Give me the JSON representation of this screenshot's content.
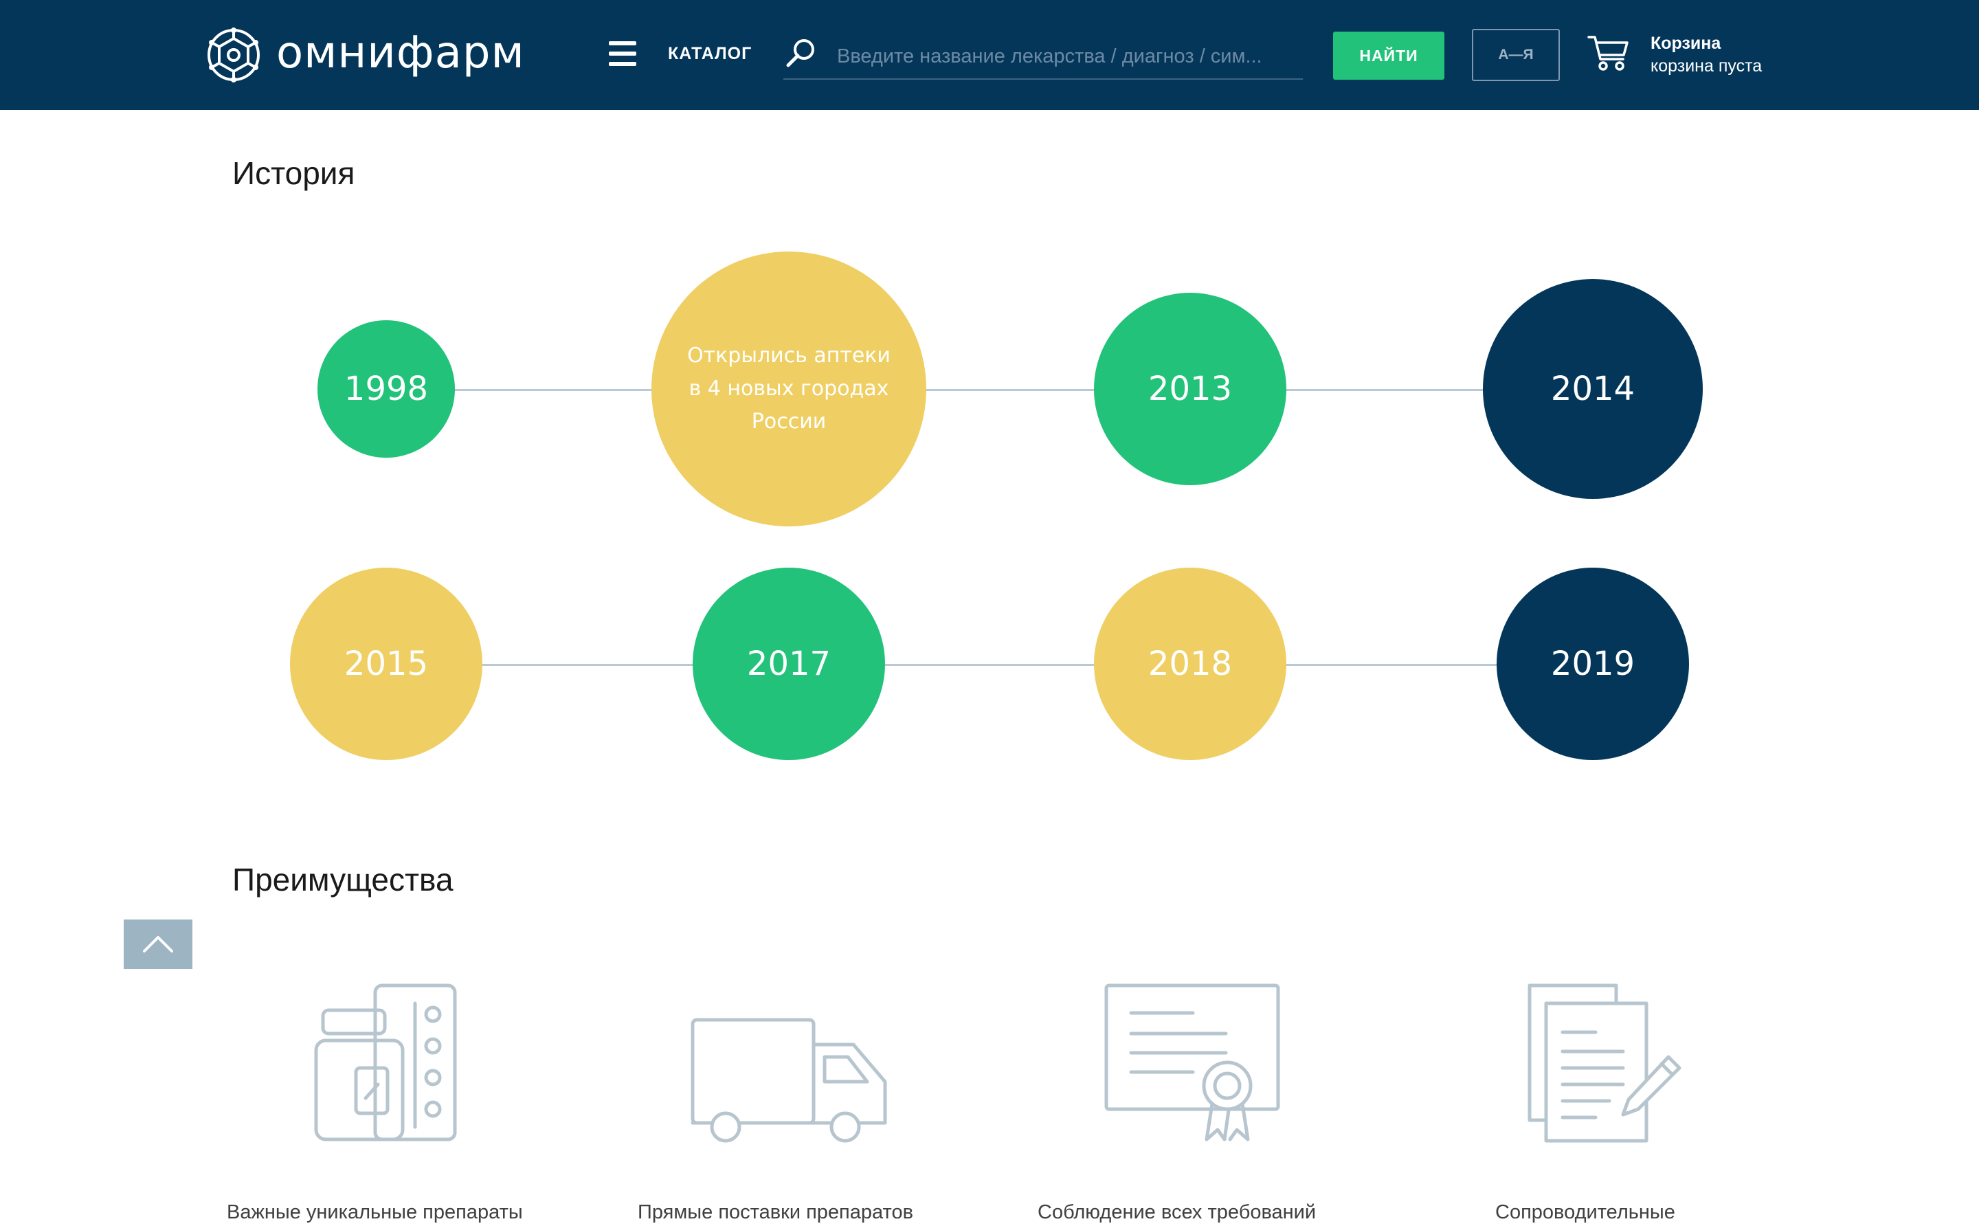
{
  "header": {
    "logo_text": "омнифарм",
    "catalog_label": "КАТАЛОГ",
    "search_placeholder": "Введите название лекарства / диагноз / сим...",
    "search_value": "",
    "find_button": "НАЙТИ",
    "az_button": "А—Я",
    "cart_title": "Корзина",
    "cart_status": "корзина пуста",
    "icons": [
      "logo-icon",
      "menu-icon",
      "search-icon",
      "cart-icon"
    ]
  },
  "history": {
    "title": "История",
    "items": [
      {
        "label": "1998",
        "color": "#22c27a"
      },
      {
        "label": "Открылись аптеки в 4 новых городах России",
        "color": "#efcf63"
      },
      {
        "label": "2013",
        "color": "#22c27a"
      },
      {
        "label": "2014",
        "color": "#04365a"
      },
      {
        "label": "2015",
        "color": "#efcf63"
      },
      {
        "label": "2017",
        "color": "#22c27a"
      },
      {
        "label": "2018",
        "color": "#efcf63"
      },
      {
        "label": "2019",
        "color": "#04365a"
      }
    ]
  },
  "benefits": {
    "title": "Преимущества",
    "items": [
      {
        "icon": "medicine-icon",
        "caption": "Важные уникальные препараты"
      },
      {
        "icon": "truck-icon",
        "caption": "Прямые поставки препаратов"
      },
      {
        "icon": "certificate-icon",
        "caption": "Соблюдение всех требований"
      },
      {
        "icon": "documents-icon",
        "caption": "Сопроводительные"
      }
    ]
  },
  "scroll_up_icon": "chevron-up-icon",
  "colors": {
    "header": "#04365a",
    "accent_green": "#22c27a",
    "accent_yellow": "#efcf63",
    "accent_navy": "#04365a",
    "icon_stroke": "#b7c5cf"
  }
}
